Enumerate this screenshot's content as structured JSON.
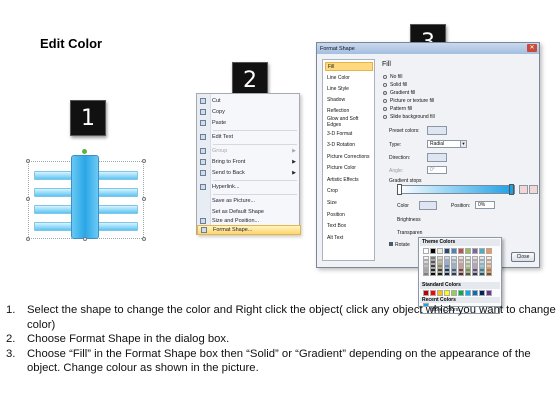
{
  "slide": {
    "title": "Edit Color",
    "steps": [
      "1",
      "2",
      "3"
    ]
  },
  "context_menu": {
    "items": [
      {
        "label": "Cut",
        "enabled": true
      },
      {
        "label": "Copy",
        "enabled": true
      },
      {
        "label": "Paste",
        "enabled": true
      },
      {
        "label": "Edit Text",
        "enabled": true
      },
      {
        "label": "Group",
        "enabled": false,
        "submenu": true
      },
      {
        "label": "Bring to Front",
        "enabled": true,
        "submenu": true
      },
      {
        "label": "Send to Back",
        "enabled": true,
        "submenu": true
      },
      {
        "label": "Hyperlink...",
        "enabled": true
      },
      {
        "label": "Save as Picture...",
        "enabled": true
      },
      {
        "label": "Set as Default Shape",
        "enabled": true
      },
      {
        "label": "Size and Position...",
        "enabled": true
      },
      {
        "label": "Format Shape...",
        "enabled": true,
        "highlighted": true
      }
    ]
  },
  "dialog": {
    "title": "Format Shape",
    "close_symbol": "✕",
    "nav_items": [
      "Fill",
      "Line Color",
      "Line Style",
      "Shadow",
      "Reflection",
      "Glow and Soft Edges",
      "3-D Format",
      "3-D Rotation",
      "Picture Corrections",
      "Picture Color",
      "Artistic Effects",
      "Crop",
      "Size",
      "Position",
      "Text Box",
      "Alt Text"
    ],
    "selected_nav": "Fill",
    "fill_heading": "Fill",
    "fill_options": [
      {
        "label": "No fill",
        "selected": false
      },
      {
        "label": "Solid fill",
        "selected": false
      },
      {
        "label": "Gradient fill",
        "selected": true
      },
      {
        "label": "Picture or texture fill",
        "selected": false
      },
      {
        "label": "Pattern fill",
        "selected": false
      },
      {
        "label": "Slide background fill",
        "selected": false
      }
    ],
    "preset_colors_label": "Preset colors:",
    "type_label": "Type:",
    "type_value": "Radial",
    "direction_label": "Direction:",
    "angle_label": "Angle:",
    "angle_value": "0°",
    "gradient_stops_label": "Gradient stops",
    "color_label": "Color",
    "position_label": "Position:",
    "position_value": "0%",
    "brightness_label": "Brightness",
    "transparency_label": "Transparen",
    "rotate_label": "Rotate",
    "close_button": "Close"
  },
  "palette": {
    "theme_label": "Theme Colors",
    "standard_label": "Standard Colors",
    "recent_label": "Recent Colors",
    "more_colors_label": "More Colors...",
    "theme_top_row": [
      "#ffffff",
      "#000000",
      "#eeece1",
      "#1f497d",
      "#4f81bd",
      "#c0504d",
      "#9bbb59",
      "#8064a2",
      "#4bacc6",
      "#f79646"
    ],
    "theme_shades": [
      [
        "#f2f2f2",
        "#7f7f7f",
        "#ddd9c3",
        "#c6d9f0",
        "#dbe5f1",
        "#f2dcdb",
        "#ebf1dd",
        "#e5e0ec",
        "#dbeef3",
        "#fdeada"
      ],
      [
        "#d8d8d8",
        "#595959",
        "#c4bd97",
        "#8db3e2",
        "#b8cce4",
        "#e5b9b7",
        "#d7e3bc",
        "#ccc1d9",
        "#b7dde8",
        "#fbd5b5"
      ],
      [
        "#bfbfbf",
        "#3f3f3f",
        "#938953",
        "#548dd4",
        "#95b3d7",
        "#d99694",
        "#c3d69b",
        "#b2a2c7",
        "#92cddc",
        "#fac08f"
      ],
      [
        "#a5a5a5",
        "#262626",
        "#494429",
        "#17365d",
        "#366092",
        "#953734",
        "#76923c",
        "#5f497a",
        "#31859b",
        "#e36c09"
      ],
      [
        "#7f7f7f",
        "#0c0c0c",
        "#1d1b10",
        "#0f243e",
        "#244061",
        "#632423",
        "#4f6128",
        "#3f3151",
        "#205867",
        "#974806"
      ]
    ],
    "standard_colors": [
      "#c00000",
      "#ff0000",
      "#ffc000",
      "#ffff00",
      "#92d050",
      "#00b050",
      "#00b0f0",
      "#0070c0",
      "#002060",
      "#7030a0"
    ],
    "recent_colors": [
      "#1ea0e6"
    ]
  },
  "instructions": [
    {
      "num": "1.",
      "text": "Select the shape to change the color and Right click the object( click any object which you want to change color)"
    },
    {
      "num": "2.",
      "text": "Choose Format Shape in the dialog box."
    },
    {
      "num": "3.",
      "text": "Choose “Fill” in the Format Shape box then “Solid” or “Gradient” depending on the appearance of the object. Change colour as shown in the picture."
    }
  ]
}
